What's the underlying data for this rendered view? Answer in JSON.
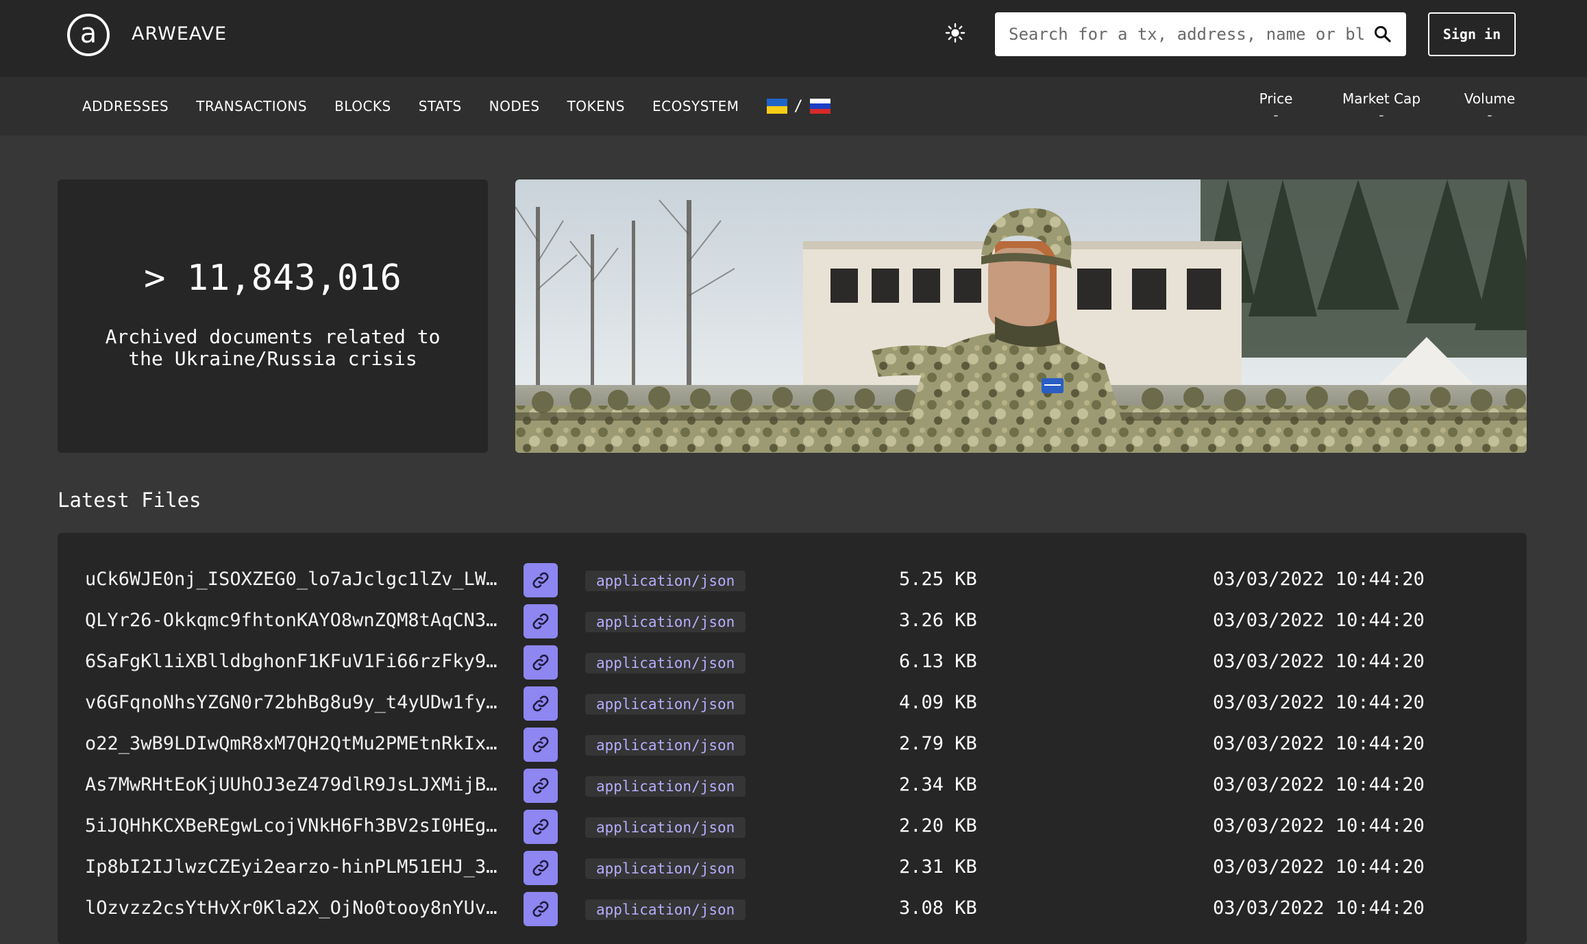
{
  "header": {
    "logo_letter": "a",
    "brand": "ARWEAVE",
    "search_placeholder": "Search for a tx, address, name or block",
    "signin_label": "Sign in"
  },
  "nav": {
    "items": [
      "ADDRESSES",
      "TRANSACTIONS",
      "BLOCKS",
      "STATS",
      "NODES",
      "TOKENS",
      "ECOSYSTEM"
    ],
    "flag_separator": "/",
    "market": [
      {
        "label": "Price",
        "value": "-"
      },
      {
        "label": "Market Cap",
        "value": "-"
      },
      {
        "label": "Volume",
        "value": "-"
      }
    ]
  },
  "hero": {
    "count": "> 11,843,016",
    "description": "Archived documents related to the Ukraine/Russia crisis"
  },
  "latest": {
    "title": "Latest Files",
    "files": [
      {
        "id": "uCk6WJE0nj_ISOXZEG0_lo7aJclgc1lZv_LW…",
        "type": "application/json",
        "size": "5.25 KB",
        "date": "03/03/2022 10:44:20"
      },
      {
        "id": "QLYr26-Okkqmc9fhtonKAYO8wnZQM8tAqCN3…",
        "type": "application/json",
        "size": "3.26 KB",
        "date": "03/03/2022 10:44:20"
      },
      {
        "id": "6SaFgKl1iXBlldbghonF1KFuV1Fi66rzFky9…",
        "type": "application/json",
        "size": "6.13 KB",
        "date": "03/03/2022 10:44:20"
      },
      {
        "id": "v6GFqnoNhsYZGN0r72bhBg8u9y_t4yUDw1fy…",
        "type": "application/json",
        "size": "4.09 KB",
        "date": "03/03/2022 10:44:20"
      },
      {
        "id": "o22_3wB9LDIwQmR8xM7QH2QtMu2PMEtnRkIx…",
        "type": "application/json",
        "size": "2.79 KB",
        "date": "03/03/2022 10:44:20"
      },
      {
        "id": "As7MwRHtEoKjUUhOJ3eZ479dlR9JsLJXMijB…",
        "type": "application/json",
        "size": "2.34 KB",
        "date": "03/03/2022 10:44:20"
      },
      {
        "id": "5iJQHhKCXBeREgwLcojVNkH6Fh3BV2sI0HEg…",
        "type": "application/json",
        "size": "2.20 KB",
        "date": "03/03/2022 10:44:20"
      },
      {
        "id": "Ip8bI2IJlwzCZEyi2earzo-hinPLM51EHJ_3…",
        "type": "application/json",
        "size": "2.31 KB",
        "date": "03/03/2022 10:44:20"
      },
      {
        "id": "lOzvzz2csYtHvXr0Kla2X_OjNo0tooy8nYUv…",
        "type": "application/json",
        "size": "3.08 KB",
        "date": "03/03/2022 10:44:20"
      }
    ]
  },
  "icons": {
    "theme": "sun-icon",
    "search": "search-icon",
    "row_link": "link-icon"
  },
  "colors": {
    "accent": "#8e86f1",
    "mime_text": "#b5aeff",
    "header_bg": "#262626",
    "page_bg": "#373737"
  }
}
